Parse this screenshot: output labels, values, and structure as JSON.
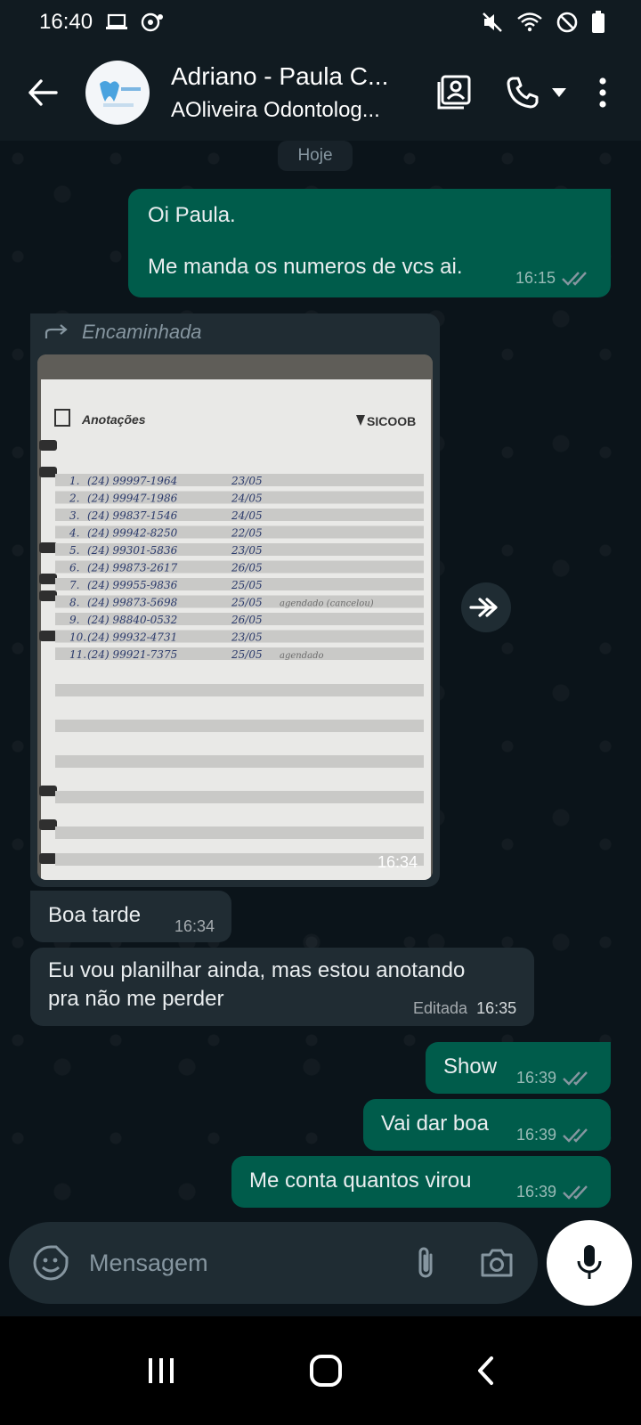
{
  "status_bar": {
    "time": "16:40"
  },
  "header": {
    "title": "Adriano  - Paula C...",
    "subtitle": "AOliveira Odontolog..."
  },
  "chat": {
    "date_label": "Hoje",
    "messages": [
      {
        "direction": "out",
        "line1": "Oi Paula.",
        "line2": "Me manda os numeros de vcs ai.",
        "time": "16:15",
        "status": "read"
      },
      {
        "direction": "in",
        "forwarded_label": "Encaminhada",
        "type": "image",
        "time": "16:34",
        "photo": {
          "heading": "Anotações",
          "brand": "SICOOB",
          "rows": [
            {
              "n": "1.",
              "phone": "(24) 99997-1964",
              "date": "23/05",
              "note": ""
            },
            {
              "n": "2.",
              "phone": "(24) 99947-1986",
              "date": "24/05",
              "note": ""
            },
            {
              "n": "3.",
              "phone": "(24) 99837-1546",
              "date": "24/05",
              "note": ""
            },
            {
              "n": "4.",
              "phone": "(24) 99942-8250",
              "date": "22/05",
              "note": ""
            },
            {
              "n": "5.",
              "phone": "(24) 99301-5836",
              "date": "23/05",
              "note": ""
            },
            {
              "n": "6.",
              "phone": "(24) 99873-2617",
              "date": "26/05",
              "note": ""
            },
            {
              "n": "7.",
              "phone": "(24) 99955-9836",
              "date": "25/05",
              "note": ""
            },
            {
              "n": "8.",
              "phone": "(24) 99873-5698",
              "date": "25/05",
              "note": "agendado (cancelou)"
            },
            {
              "n": "9.",
              "phone": "(24) 98840-0532",
              "date": "26/05",
              "note": ""
            },
            {
              "n": "10.",
              "phone": "(24) 99932-4731",
              "date": "23/05",
              "note": ""
            },
            {
              "n": "11.",
              "phone": "(24) 99921-7375",
              "date": "25/05",
              "note": "agendado"
            }
          ]
        }
      },
      {
        "direction": "in",
        "text": "Boa tarde",
        "time": "16:34"
      },
      {
        "direction": "in",
        "line1": "Eu vou planilhar ainda, mas estou anotando",
        "line2": "pra não me perder",
        "edited_label": "Editada",
        "time": "16:35"
      },
      {
        "direction": "out",
        "text": "Show",
        "time": "16:39",
        "status": "read"
      },
      {
        "direction": "out",
        "text": "Vai dar boa",
        "time": "16:39",
        "status": "read"
      },
      {
        "direction": "out",
        "text": "Me conta quantos virou",
        "time": "16:39",
        "status": "read"
      }
    ]
  },
  "composer": {
    "placeholder": "Mensagem"
  },
  "colors": {
    "outgoing": "#005c4b",
    "incoming": "#202c33",
    "background": "#0b141a",
    "tick": "#8696a0"
  }
}
